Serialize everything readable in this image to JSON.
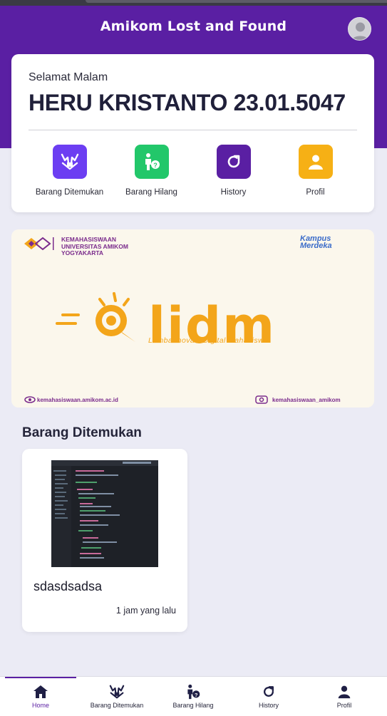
{
  "app": {
    "title": "Amikom Lost and Found"
  },
  "greeting": {
    "salutation": "Selamat Malam",
    "user": "HERU KRISTANTO 23.01.5047"
  },
  "quick_menu": [
    {
      "label": "Barang Ditemukan",
      "icon": "hands-icon",
      "color": "#6c3ef2"
    },
    {
      "label": "Barang Hilang",
      "icon": "person-question-icon",
      "color": "#22c76a"
    },
    {
      "label": "History",
      "icon": "refresh-icon",
      "color": "#5a1fa3"
    },
    {
      "label": "Profil",
      "icon": "user-icon",
      "color": "#f6b015"
    }
  ],
  "banner": {
    "org_line1": "KEMAHASISWAAN",
    "org_line2": "UNIVERSITAS AMIKOM",
    "org_line3": "YOGYAKARTA",
    "merdeka_line1": "Kampus",
    "merdeka_line2": "Merdeka",
    "logo_text": "lidm",
    "tagline": "Lomba Inovasi Digital Mahasiswa",
    "website": "kemahasiswaan.amikom.ac.id",
    "instagram": "kemahasiswaan_amikom"
  },
  "found_section": {
    "title": "Barang Ditemukan",
    "items": [
      {
        "name": "sdasdsadsa",
        "time": "1 jam yang lalu"
      }
    ]
  },
  "bottom_nav": [
    {
      "label": "Home",
      "icon": "home-icon",
      "active": true
    },
    {
      "label": "Barang Ditemukan",
      "icon": "hands-icon",
      "active": false
    },
    {
      "label": "Barang Hilang",
      "icon": "person-question-icon",
      "active": false
    },
    {
      "label": "History",
      "icon": "refresh-icon",
      "active": false
    },
    {
      "label": "Profil",
      "icon": "user-icon",
      "active": false
    }
  ],
  "colors": {
    "primary": "#5a1fa3",
    "background": "#ebebf5",
    "accent_orange": "#f3a51a"
  }
}
